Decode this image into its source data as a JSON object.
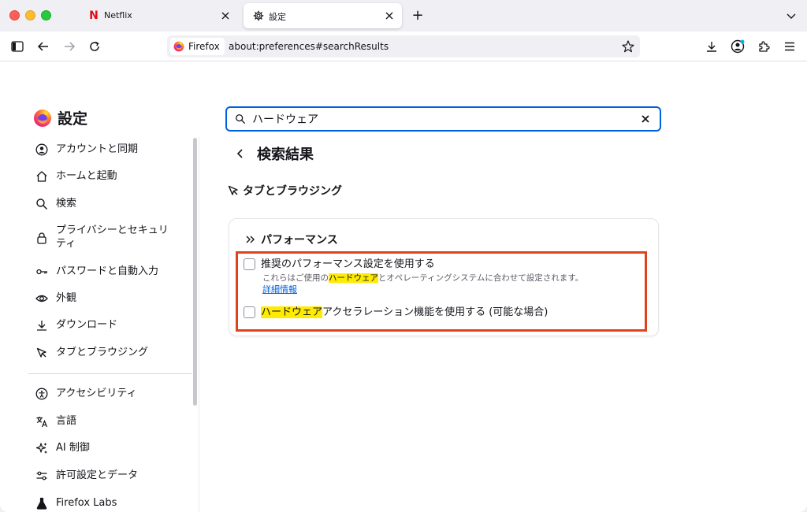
{
  "tabs": [
    {
      "label": "Netflix",
      "icon": "netflix-icon"
    },
    {
      "label": "設定",
      "icon": "gear-icon"
    }
  ],
  "newtab_label": "+",
  "urlbar": {
    "identity_label": "Firefox",
    "url": "about:preferences#searchResults"
  },
  "sidebar": {
    "title": "設定",
    "items": [
      {
        "label": "アカウントと同期",
        "icon": "account-icon"
      },
      {
        "label": "ホームと起動",
        "icon": "home-icon"
      },
      {
        "label": "検索",
        "icon": "search-icon"
      },
      {
        "label": "プライバシーとセキュリティ",
        "icon": "lock-icon"
      },
      {
        "label": "パスワードと自動入力",
        "icon": "key-icon"
      },
      {
        "label": "外観",
        "icon": "eye-icon"
      },
      {
        "label": "ダウンロード",
        "icon": "download-icon"
      },
      {
        "label": "タブとブラウジング",
        "icon": "cursor-icon"
      },
      {
        "label": "アクセシビリティ",
        "icon": "accessibility-icon"
      },
      {
        "label": "言語",
        "icon": "language-icon"
      },
      {
        "label": "AI 制御",
        "icon": "sparkle-icon"
      },
      {
        "label": "許可設定とデータ",
        "icon": "sliders-icon"
      },
      {
        "label": "Firefox Labs",
        "icon": "flask-icon"
      }
    ]
  },
  "search": {
    "value": "ハードウェア"
  },
  "results_title": "検索結果",
  "section_title": "タブとブラウジング",
  "card": {
    "title": "パフォーマンス",
    "option1": {
      "label": "推奨のパフォーマンス設定を使用する",
      "desc_before": "これらはご使用の",
      "desc_highlight": "ハードウェア",
      "desc_after": "とオペレーティングシステムに合わせて設定されます。",
      "link": "詳細情報"
    },
    "option2": {
      "label_highlight": "ハードウェア",
      "label_after": "アクセラレーション機能を使用する (可能な場合)"
    }
  },
  "colors": {
    "accent": "#0061e0",
    "highlight": "#ffeb00",
    "annotation_box": "#e0421e"
  }
}
